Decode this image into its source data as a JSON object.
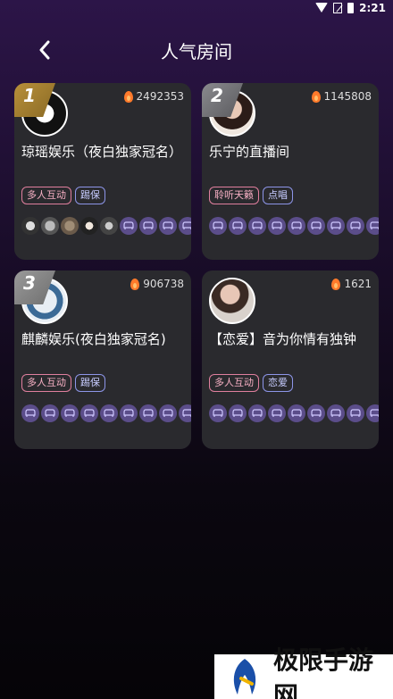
{
  "status_bar": {
    "time": "2:21",
    "icons": [
      "wifi-icon",
      "signal-icon",
      "battery-icon"
    ]
  },
  "header": {
    "title": "人气房间"
  },
  "rooms": [
    {
      "rank": "1",
      "heat": "2492353",
      "name": "琼瑶娱乐（夜白独家冠名）",
      "tags": [
        "多人互动",
        "踢保"
      ],
      "seats_filled": 5,
      "seats_empty": 4
    },
    {
      "rank": "2",
      "heat": "1145808",
      "name": "乐宁的直播间",
      "tags": [
        "聆听天籁",
        "点唱"
      ],
      "seats_filled": 0,
      "seats_empty": 9
    },
    {
      "rank": "3",
      "heat": "906738",
      "name": "麒麟娱乐(夜白独家冠名)",
      "tags": [
        "多人互动",
        "踢保"
      ],
      "seats_filled": 0,
      "seats_empty": 9
    },
    {
      "rank": "",
      "heat": "1621",
      "name": "【恋爱】音为你情有独钟",
      "tags": [
        "多人互动",
        "恋爱"
      ],
      "seats_filled": 0,
      "seats_empty": 9
    }
  ],
  "watermark": {
    "text": "极限手游网"
  },
  "colors": {
    "card_bg": "#2a2a2e",
    "seat_purple": "#5b4d8a",
    "tag_pink": "#e07f9e",
    "tag_blue": "#8d95e8",
    "flame": "#ff7a2b",
    "rank_gold": "#b8903a"
  }
}
